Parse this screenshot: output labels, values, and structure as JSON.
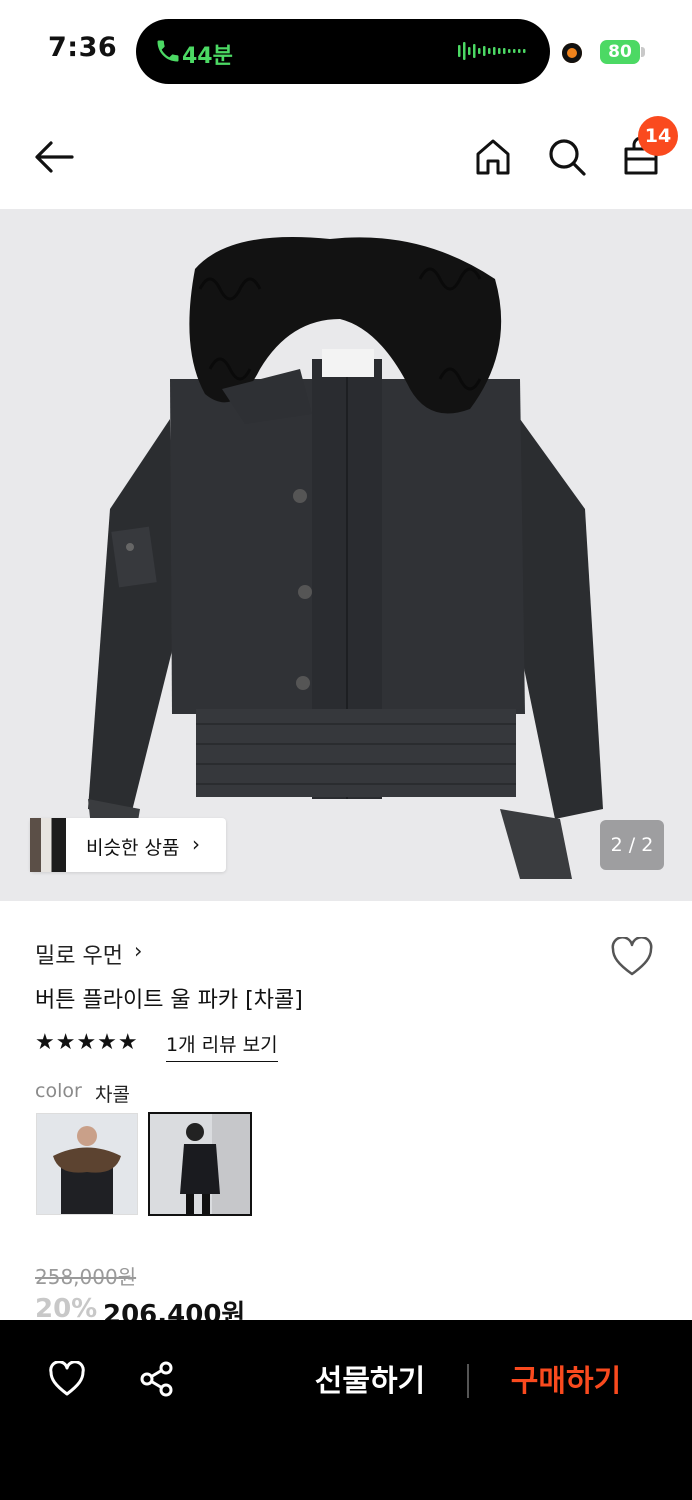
{
  "status_bar": {
    "time": "7:36",
    "call_duration": "44분",
    "battery_level": "80"
  },
  "header": {
    "back_icon": "arrow-left-icon",
    "home_icon": "home-icon",
    "search_icon": "search-icon",
    "cart_icon": "shopping-bag-icon",
    "cart_count": "14"
  },
  "gallery": {
    "similar_products_label": "비슷한 상품",
    "similar_chevron": "›",
    "page_indicator": "2 / 2"
  },
  "product": {
    "brand": "밀로 우먼",
    "brand_chevron": "›",
    "title": "버튼 플라이트 울 파카 [차콜]",
    "rating_stars": "★★★★★",
    "rating_value": 5,
    "review_link": "1개 리뷰 보기",
    "color_label": "color",
    "color_value": "차콜",
    "original_price": "258,000원",
    "discount_rate": "20%",
    "final_price": "206,400원"
  },
  "bottom_bar": {
    "wishlist_icon": "heart-icon",
    "share_icon": "share-icon",
    "gift_label": "선물하기",
    "buy_label": "구매하기"
  },
  "colors": {
    "accent": "#fa4a1e",
    "call_green": "#4cd964",
    "gallery_bg": "#e9e9eb"
  }
}
